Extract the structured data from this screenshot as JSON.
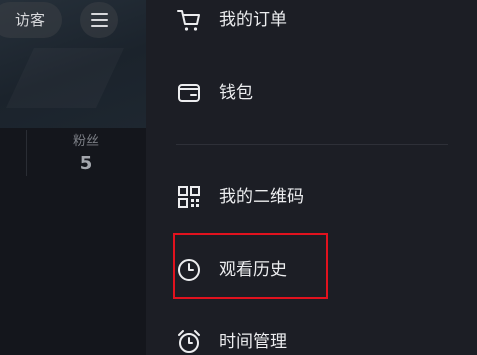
{
  "profile": {
    "visitor_label": "访客",
    "fans_label": "粉丝",
    "fans_count": "5"
  },
  "drawer": {
    "items": [
      {
        "label": "我的订单",
        "icon": "cart-icon"
      },
      {
        "label": "钱包",
        "icon": "wallet-icon"
      },
      {
        "label": "我的二维码",
        "icon": "qr-code-icon"
      },
      {
        "label": "观看历史",
        "icon": "clock-icon"
      },
      {
        "label": "时间管理",
        "icon": "alarm-clock-icon"
      }
    ]
  },
  "colors": {
    "drawer_bg": "#1c1e25",
    "text": "#ecedef",
    "highlight": "#e1121e"
  }
}
